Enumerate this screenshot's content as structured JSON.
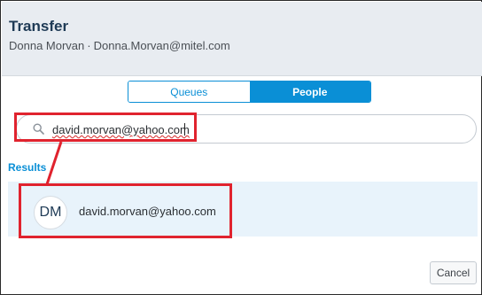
{
  "dialog": {
    "title": "Transfer",
    "caller_name": "Donna Morvan",
    "separator": "·",
    "caller_email": "Donna.Morvan@mitel.com"
  },
  "tabs": [
    {
      "label": "Queues",
      "selected": false
    },
    {
      "label": "People",
      "selected": true
    }
  ],
  "search": {
    "value": "david.morvan@yahoo.com",
    "icon": "search-icon"
  },
  "results": {
    "label": "Results",
    "items": [
      {
        "initials": "DM",
        "email": "david.morvan@yahoo.com"
      }
    ]
  },
  "footer": {
    "cancel_label": "Cancel"
  },
  "colors": {
    "accent": "#0a8fd6",
    "header_bg": "#e8ecf1",
    "title": "#1e3a55",
    "highlight_box": "#e0232e",
    "result_bg": "#e8f3fb"
  }
}
